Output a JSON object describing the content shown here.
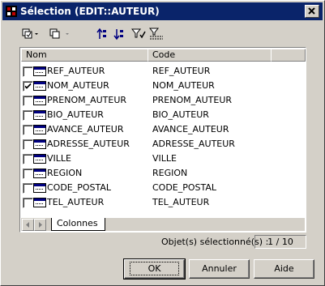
{
  "window": {
    "title": "Sélection (EDIT::AUTEUR)"
  },
  "toolbar": {
    "buttons": [
      {
        "icon": "select-all-icon"
      },
      {
        "icon": "deselect-all-icon"
      },
      {
        "icon": "sort-up-icon"
      },
      {
        "icon": "sort-down-icon"
      },
      {
        "icon": "filter-icon"
      },
      {
        "icon": "filter-options-icon"
      }
    ]
  },
  "list": {
    "columns": [
      "Nom",
      "Code"
    ],
    "rows": [
      {
        "name": "REF_AUTEUR",
        "code": "REF_AUTEUR",
        "checked": false
      },
      {
        "name": "NOM_AUTEUR",
        "code": "NOM_AUTEUR",
        "checked": true
      },
      {
        "name": "PRENOM_AUTEUR",
        "code": "PRENOM_AUTEUR",
        "checked": false
      },
      {
        "name": "BIO_AUTEUR",
        "code": "BIO_AUTEUR",
        "checked": false
      },
      {
        "name": "AVANCE_AUTEUR",
        "code": "AVANCE_AUTEUR",
        "checked": false
      },
      {
        "name": "ADRESSE_AUTEUR",
        "code": "ADRESSE_AUTEUR",
        "checked": false
      },
      {
        "name": "VILLE",
        "code": "VILLE",
        "checked": false
      },
      {
        "name": "REGION",
        "code": "REGION",
        "checked": false
      },
      {
        "name": "CODE_POSTAL",
        "code": "CODE_POSTAL",
        "checked": false
      },
      {
        "name": "TEL_AUTEUR",
        "code": "TEL_AUTEUR",
        "checked": false
      }
    ]
  },
  "tab": {
    "label": "Colonnes"
  },
  "status": {
    "label": "Objet(s) sélectionné(s) :",
    "value": "1 / 10"
  },
  "buttons": {
    "ok": "OK",
    "cancel": "Annuler",
    "help": "Aide"
  },
  "colors": {
    "titlebar": "#0a246a",
    "face": "#d4d0c8"
  }
}
